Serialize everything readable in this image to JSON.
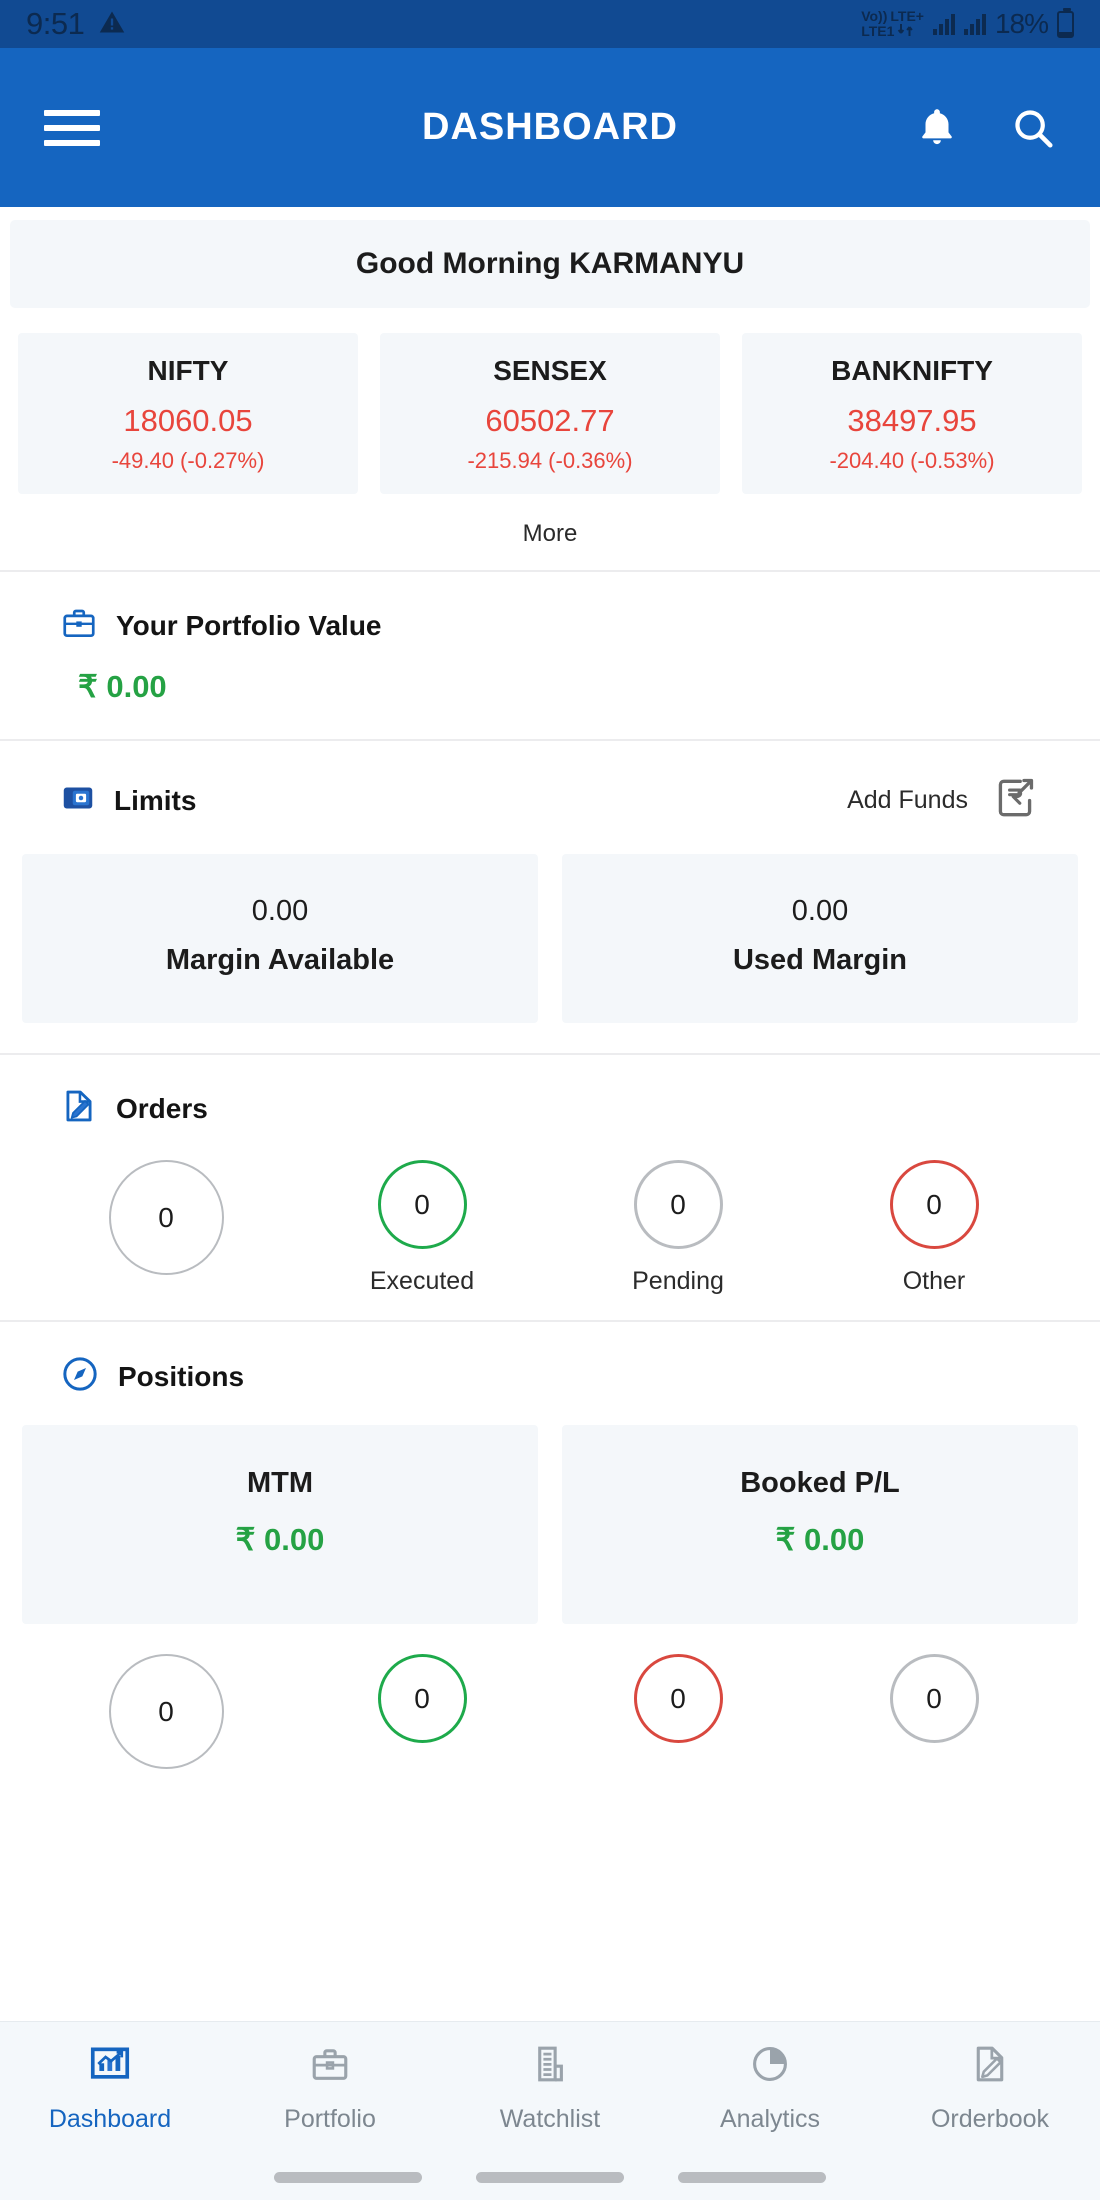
{
  "status_bar": {
    "time": "9:51",
    "warning_icon": "warning-triangle-icon",
    "volte_label": "Vo))",
    "network_label": "LTE1",
    "lte_plus_label": "LTE+",
    "battery_percent": "18%"
  },
  "app_bar": {
    "title": "DASHBOARD",
    "menu_icon": "hamburger-menu-icon",
    "notification_icon": "bell-icon",
    "search_icon": "search-icon"
  },
  "greeting": {
    "text": "Good Morning KARMANYU"
  },
  "indices": [
    {
      "name": "NIFTY",
      "ltp": "18060.05",
      "change": "-49.40  (-0.27%)"
    },
    {
      "name": "SENSEX",
      "ltp": "60502.77",
      "change": "-215.94  (-0.36%)"
    },
    {
      "name": "BANKNIFTY",
      "ltp": "38497.95",
      "change": "-204.40  (-0.53%)"
    }
  ],
  "more_label": "More",
  "portfolio": {
    "icon": "briefcase-icon",
    "title": "Your Portfolio Value",
    "value": "₹ 0.00"
  },
  "limits": {
    "icon": "wallet-card-icon",
    "title": "Limits",
    "add_funds_label": "Add Funds",
    "add_funds_icon": "rupee-transfer-icon",
    "tiles": [
      {
        "value": "0.00",
        "label": "Margin Available"
      },
      {
        "value": "0.00",
        "label": "Used Margin"
      }
    ]
  },
  "orders": {
    "icon": "order-edit-icon",
    "title": "Orders",
    "circles": [
      {
        "count": "0",
        "label": "",
        "color": "gray",
        "size": "big"
      },
      {
        "count": "0",
        "label": "Executed",
        "color": "green",
        "size": "sm"
      },
      {
        "count": "0",
        "label": "Pending",
        "color": "gray",
        "size": "sm"
      },
      {
        "count": "0",
        "label": "Other",
        "color": "red",
        "size": "sm"
      }
    ]
  },
  "positions": {
    "icon": "compass-icon",
    "title": "Positions",
    "tiles": [
      {
        "label": "MTM",
        "value": "₹ 0.00"
      },
      {
        "label": "Booked P/L",
        "value": "₹ 0.00"
      }
    ],
    "circles": [
      {
        "count": "0",
        "color": "gray",
        "size": "big"
      },
      {
        "count": "0",
        "color": "green",
        "size": "sm"
      },
      {
        "count": "0",
        "color": "red",
        "size": "sm"
      },
      {
        "count": "0",
        "color": "gray",
        "size": "sm"
      }
    ]
  },
  "bottom_nav": [
    {
      "label": "Dashboard",
      "icon": "chart-growth-icon",
      "active": true
    },
    {
      "label": "Portfolio",
      "icon": "briefcase-icon",
      "active": false
    },
    {
      "label": "Watchlist",
      "icon": "list-document-icon",
      "active": false
    },
    {
      "label": "Analytics",
      "icon": "pie-chart-icon",
      "active": false
    },
    {
      "label": "Orderbook",
      "icon": "order-edit-icon",
      "active": false
    }
  ],
  "colors": {
    "status_bar_bg": "#114a92",
    "app_bar_bg": "#1565c0",
    "card_bg": "#f4f7fa",
    "negative": "#e8453c",
    "positive": "#25a244",
    "accent": "#1565c0",
    "green_ring": "#1eaa4b",
    "red_ring": "#d9483f",
    "gray_ring": "#b9bcc0"
  }
}
